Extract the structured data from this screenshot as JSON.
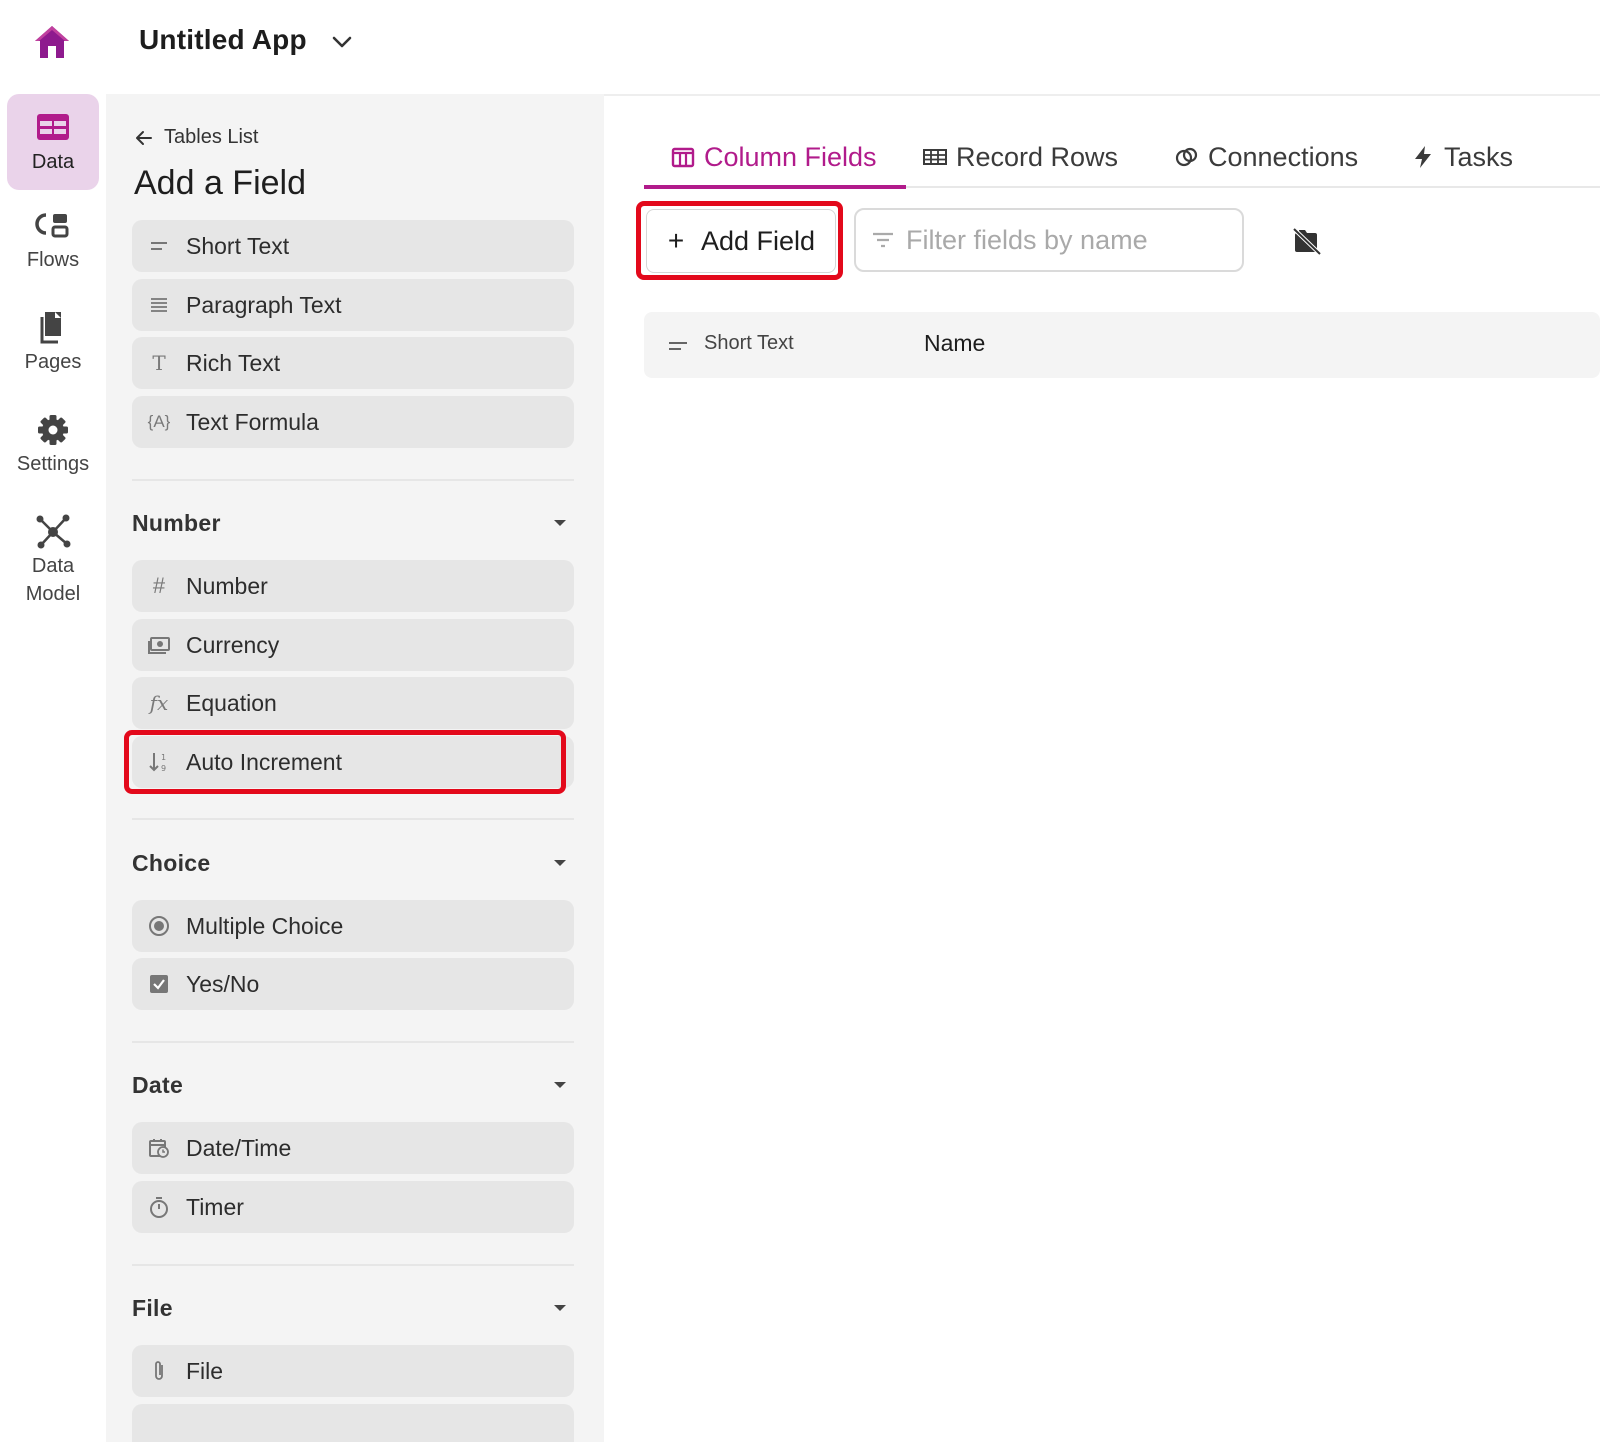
{
  "app": {
    "title": "Untitled App"
  },
  "rail": {
    "items": [
      {
        "label": "Data",
        "icon": "table-icon"
      },
      {
        "label": "Flows",
        "icon": "flows-icon"
      },
      {
        "label": "Pages",
        "icon": "pages-icon"
      },
      {
        "label": "Settings",
        "icon": "gear-icon"
      },
      {
        "label_line1": "Data",
        "label_line2": "Model",
        "icon": "data-model-icon"
      }
    ]
  },
  "panel": {
    "back_label": "Tables List",
    "title": "Add a Field",
    "text_fields": [
      "Short Text",
      "Paragraph Text",
      "Rich Text",
      "Text Formula"
    ],
    "sections": {
      "number": {
        "title": "Number",
        "items": [
          "Number",
          "Currency",
          "Equation",
          "Auto Increment"
        ]
      },
      "choice": {
        "title": "Choice",
        "items": [
          "Multiple Choice",
          "Yes/No"
        ]
      },
      "date": {
        "title": "Date",
        "items": [
          "Date/Time",
          "Timer"
        ]
      },
      "file": {
        "title": "File",
        "items": [
          "File"
        ]
      }
    }
  },
  "main": {
    "tabs": [
      {
        "label": "Column Fields",
        "active": true
      },
      {
        "label": "Record Rows"
      },
      {
        "label": "Connections"
      },
      {
        "label": "Tasks"
      }
    ],
    "add_field_label": "Add Field",
    "filter_placeholder": "Filter fields by name",
    "fields": [
      {
        "type": "Short Text",
        "name": "Name"
      }
    ]
  },
  "colors": {
    "accent": "#b11b8b",
    "highlight": "#e3091b",
    "rail_active": "#ead3ea",
    "home_icon": "#8e1a8e"
  }
}
